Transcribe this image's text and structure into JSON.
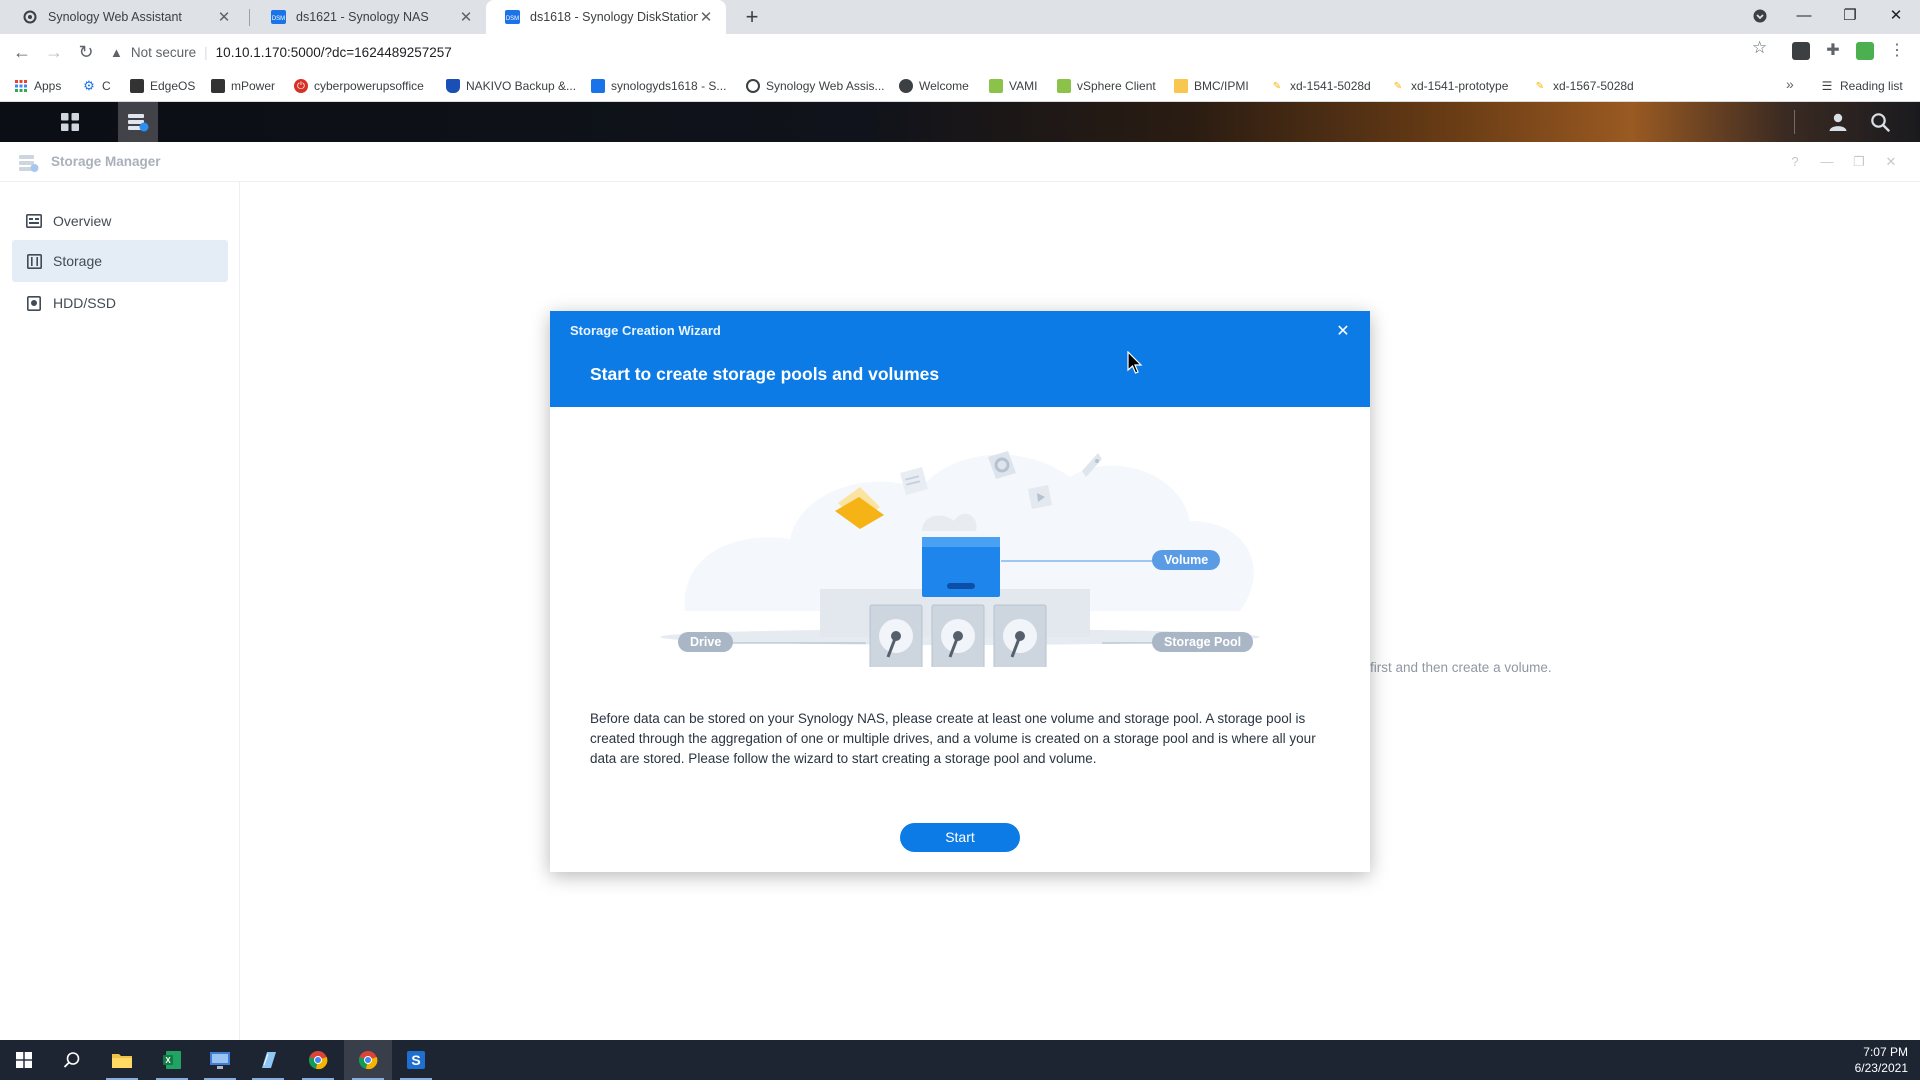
{
  "browser": {
    "tabs": [
      {
        "title": "Synology Web Assistant",
        "active": false
      },
      {
        "title": "ds1621 - Synology NAS",
        "active": false
      },
      {
        "title": "ds1618 - Synology DiskStation",
        "active": true
      }
    ],
    "not_secure_label": "Not secure",
    "url": "10.10.1.170:5000/?dc=1624489257257",
    "bookmarks": [
      {
        "label": "Apps"
      },
      {
        "label": "C"
      },
      {
        "label": "EdgeOS"
      },
      {
        "label": "mPower"
      },
      {
        "label": "cyberpowerupsoffice"
      },
      {
        "label": "NAKIVO Backup &..."
      },
      {
        "label": "synologyds1618 - S..."
      },
      {
        "label": "Synology Web Assis..."
      },
      {
        "label": "Welcome"
      },
      {
        "label": "VAMI"
      },
      {
        "label": "vSphere Client"
      },
      {
        "label": "BMC/IPMI"
      },
      {
        "label": "xd-1541-5028d"
      },
      {
        "label": "xd-1541-prototype"
      },
      {
        "label": "xd-1567-5028d"
      }
    ],
    "reading_list": "Reading list"
  },
  "storage_manager": {
    "title": "Storage Manager",
    "nav": [
      {
        "label": "Overview",
        "icon": "overview-icon",
        "selected": false
      },
      {
        "label": "Storage",
        "icon": "storage-icon",
        "selected": true
      },
      {
        "label": "HDD/SSD",
        "icon": "hdd-icon",
        "selected": false
      }
    ],
    "background_hint": "first and then create a volume."
  },
  "wizard": {
    "window_title": "Storage Creation Wizard",
    "heading": "Start to create storage pools and volumes",
    "labels": {
      "volume": "Volume",
      "drive": "Drive",
      "storage_pool": "Storage Pool"
    },
    "description": "Before data can be stored on your Synology NAS, please create at least one volume and storage pool. A storage pool is created through the aggregation of one or multiple drives, and a volume is created on a storage pool and is where all your data are stored. Please follow the wizard to start creating a storage pool and volume.",
    "start_label": "Start"
  },
  "taskbar": {
    "time": "7:07 PM",
    "date": "6/23/2021"
  },
  "colors": {
    "accent": "#0d7be6",
    "pill_blue": "#5a9be6",
    "pill_gray": "#a9b6c6",
    "taskbar": "#1d2533"
  }
}
